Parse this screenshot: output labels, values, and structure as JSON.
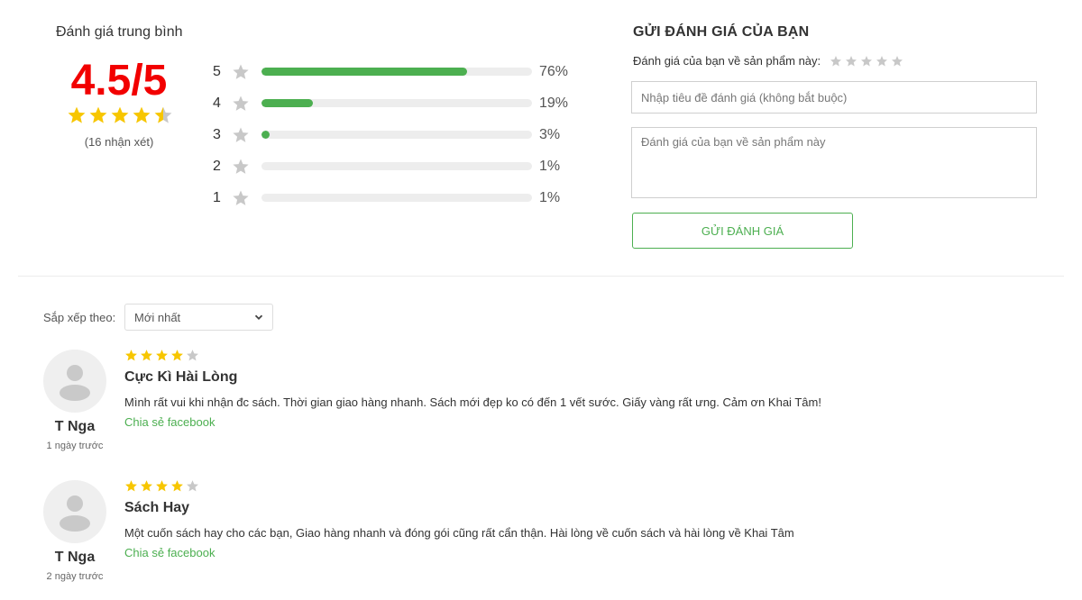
{
  "summary": {
    "title": "Đánh giá trung bình",
    "score": "4.5/5",
    "stars": [
      1,
      1,
      1,
      1,
      0.5
    ],
    "review_count": "(16 nhận xét)",
    "breakdown": [
      {
        "stars": "5",
        "percent_value": 76,
        "percent": "76%"
      },
      {
        "stars": "4",
        "percent_value": 19,
        "percent": "19%"
      },
      {
        "stars": "3",
        "percent_value": 3,
        "percent": "3%"
      },
      {
        "stars": "2",
        "percent_value": 1,
        "percent": "1%"
      },
      {
        "stars": "1",
        "percent_value": 1,
        "percent": "1%"
      }
    ]
  },
  "form": {
    "title": "GỬI ĐÁNH GIÁ CỦA BẠN",
    "prompt": "Đánh giá của bạn về sản phẩm này:",
    "title_placeholder": "Nhập tiêu đề đánh giá (không bắt buộc)",
    "body_placeholder": "Đánh giá của bạn về sản phẩm này",
    "submit_label": "GỬI ĐÁNH GIÁ"
  },
  "sort": {
    "label": "Sắp xếp theo:",
    "selected": "Mới nhất"
  },
  "reviews": [
    {
      "author": "T Nga",
      "time": "1 ngày trước",
      "rating": 4,
      "title": "Cực Kì Hài Lòng",
      "body": "Mình rất vui khi nhận đc sách. Thời gian giao hàng nhanh. Sách mới đẹp ko có đến 1 vết sước. Giấy vàng rất ưng. Cảm ơn Khai Tâm!",
      "share": "Chia sẻ facebook"
    },
    {
      "author": "T Nga",
      "time": "2 ngày trước",
      "rating": 4,
      "title": "Sách Hay",
      "body": "Một cuốn sách hay cho các bạn, Giao hàng nhanh và đóng gói cũng rất cẩn thận. Hài lòng về cuốn sách và hài lòng về Khai Tâm",
      "share": "Chia sẻ facebook"
    }
  ],
  "colors": {
    "score": "#f20000",
    "star_filled": "#f7c600",
    "star_empty": "#c8c8c8",
    "bar_fill": "#4caf50",
    "accent": "#4caf50"
  }
}
